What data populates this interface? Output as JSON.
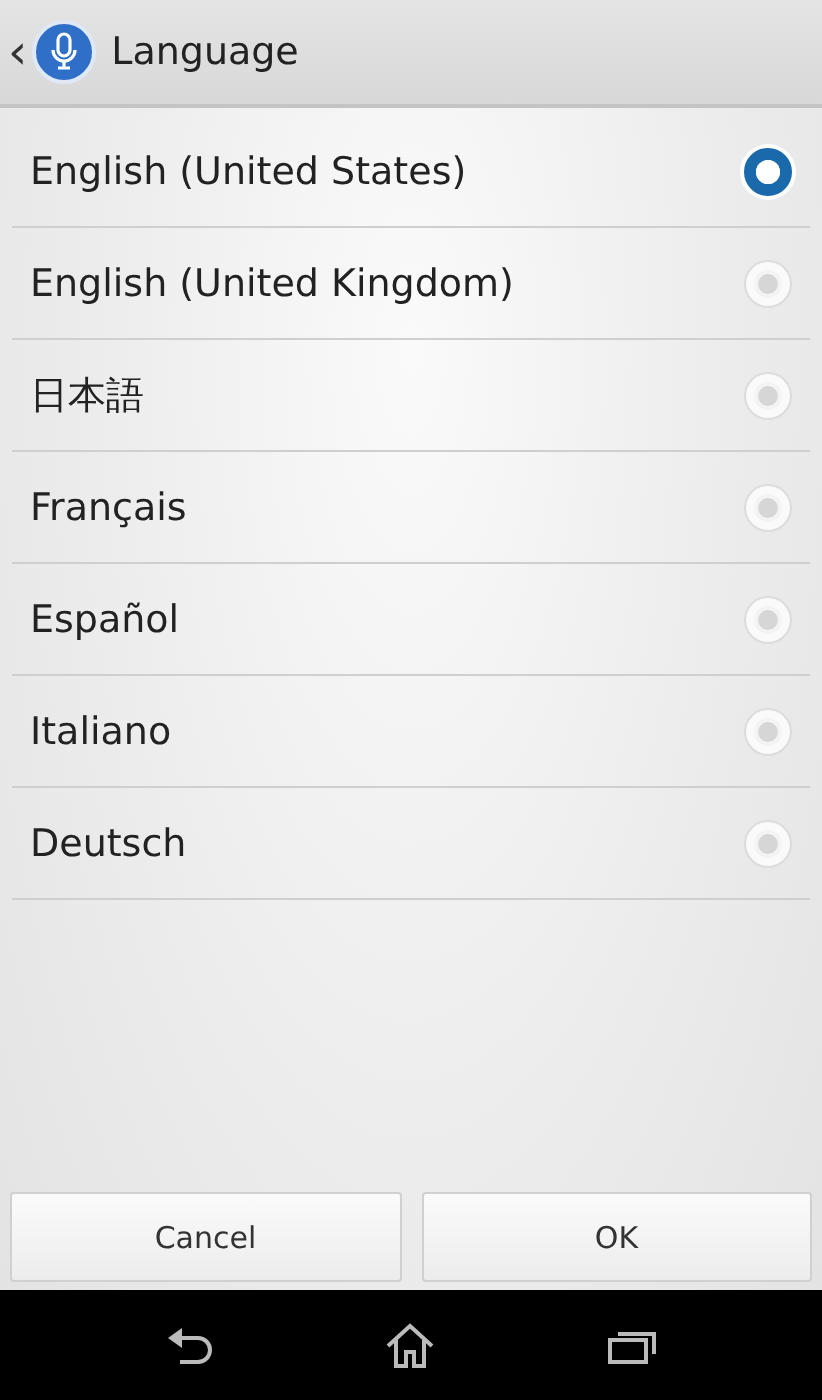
{
  "header": {
    "back": "‹",
    "title": "Language"
  },
  "languages": [
    {
      "label": "English (United States)",
      "selected": true
    },
    {
      "label": "English (United Kingdom)",
      "selected": false
    },
    {
      "label": "日本語",
      "selected": false
    },
    {
      "label": "Français",
      "selected": false
    },
    {
      "label": "Español",
      "selected": false
    },
    {
      "label": "Italiano",
      "selected": false
    },
    {
      "label": "Deutsch",
      "selected": false
    }
  ],
  "buttons": [
    "Cancel",
    "OK"
  ]
}
